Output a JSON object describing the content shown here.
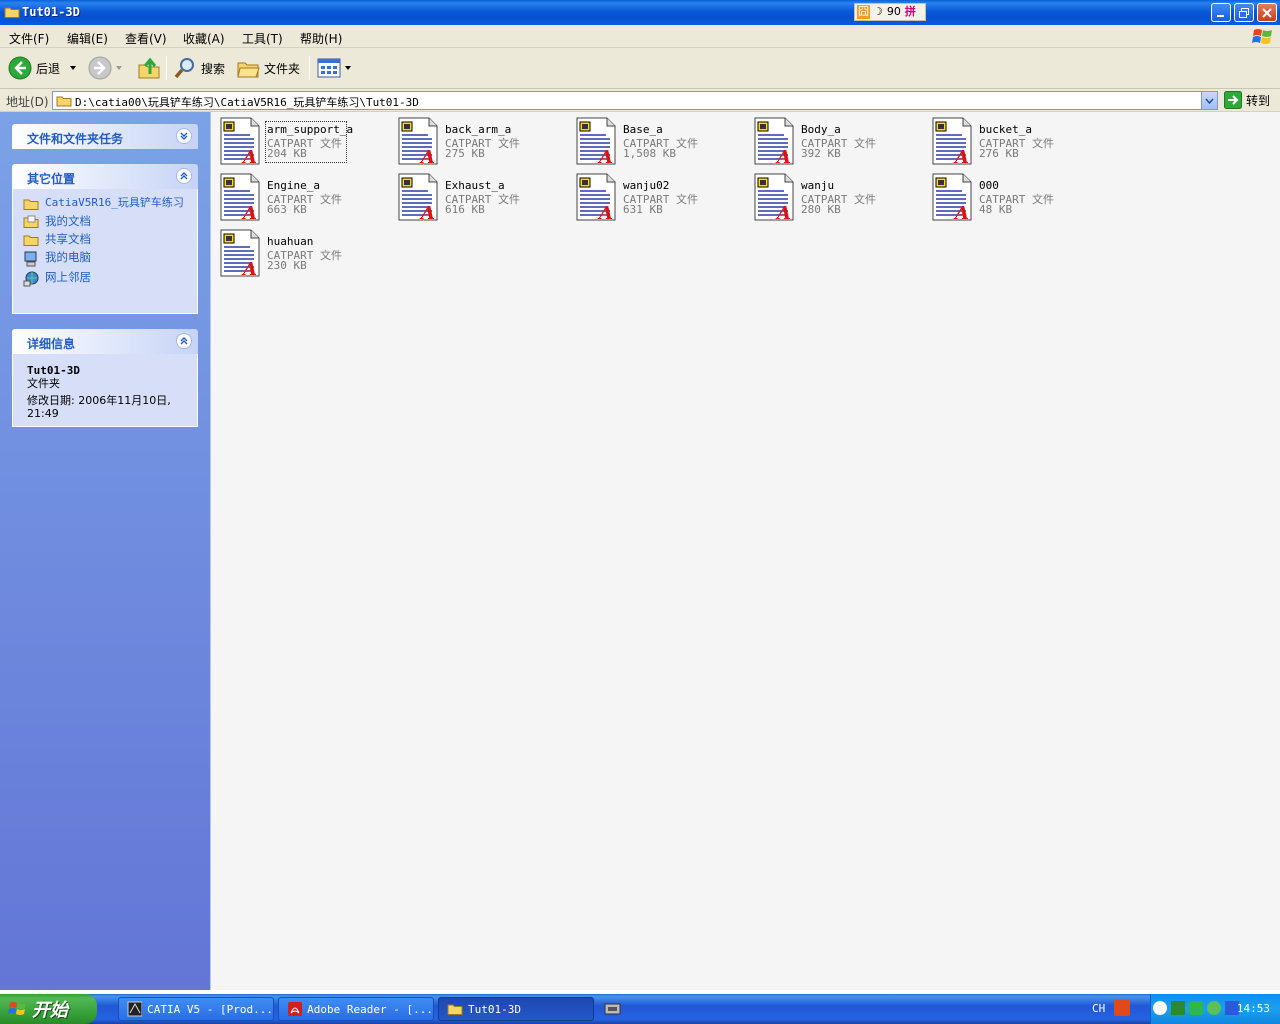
{
  "window": {
    "title": "Tut01-3D"
  },
  "ime": {
    "cells": [
      "囧",
      "☽",
      "90",
      "拼"
    ]
  },
  "menu": [
    {
      "label": "文件(F)"
    },
    {
      "label": "编辑(E)"
    },
    {
      "label": "查看(V)"
    },
    {
      "label": "收藏(A)"
    },
    {
      "label": "工具(T)"
    },
    {
      "label": "帮助(H)"
    }
  ],
  "toolbar": {
    "back_label": "后退",
    "search_label": "搜索",
    "folders_label": "文件夹"
  },
  "address": {
    "label": "地址(D)",
    "path": "D:\\catia00\\玩具铲车练习\\CatiaV5R16_玩具铲车练习\\Tut01-3D",
    "go_label": "转到"
  },
  "leftpane": {
    "tasks_title": "文件和文件夹任务",
    "places_title": "其它位置",
    "places": [
      {
        "label": "CatiaV5R16_玩具铲车练习"
      },
      {
        "label": "我的文档"
      },
      {
        "label": "共享文档"
      },
      {
        "label": "我的电脑"
      },
      {
        "label": "网上邻居"
      }
    ],
    "details_title": "详细信息",
    "details": {
      "name": "Tut01-3D",
      "type": "文件夹",
      "modified": "修改日期: 2006年11月10日, 21:49"
    }
  },
  "files": [
    {
      "name": "arm_support_a",
      "type": "CATPART 文件",
      "size": "204 KB"
    },
    {
      "name": "back_arm_a",
      "type": "CATPART 文件",
      "size": "275 KB"
    },
    {
      "name": "Base_a",
      "type": "CATPART 文件",
      "size": "1,508 KB"
    },
    {
      "name": "Body_a",
      "type": "CATPART 文件",
      "size": "392 KB"
    },
    {
      "name": "bucket_a",
      "type": "CATPART 文件",
      "size": "276 KB"
    },
    {
      "name": "Engine_a",
      "type": "CATPART 文件",
      "size": "663 KB"
    },
    {
      "name": "Exhaust_a",
      "type": "CATPART 文件",
      "size": "616 KB"
    },
    {
      "name": "wanju02",
      "type": "CATPART 文件",
      "size": "631 KB"
    },
    {
      "name": "wanju",
      "type": "CATPART 文件",
      "size": "280 KB"
    },
    {
      "name": "000",
      "type": "CATPART 文件",
      "size": "48 KB"
    },
    {
      "name": "huahuan",
      "type": "CATPART 文件",
      "size": "230 KB"
    }
  ],
  "taskbar": {
    "start_label": "开始",
    "tasks": [
      {
        "label": "CATIA V5 - [Prod..."
      },
      {
        "label": "Adobe Reader - [..."
      },
      {
        "label": "Tut01-3D"
      }
    ],
    "lang": "CH",
    "clock": "14:53"
  },
  "colors": {
    "titlebar": "#0a58d8",
    "taskpane": "#7ba2e7",
    "link": "#215dc6",
    "start": "#37a33a"
  }
}
